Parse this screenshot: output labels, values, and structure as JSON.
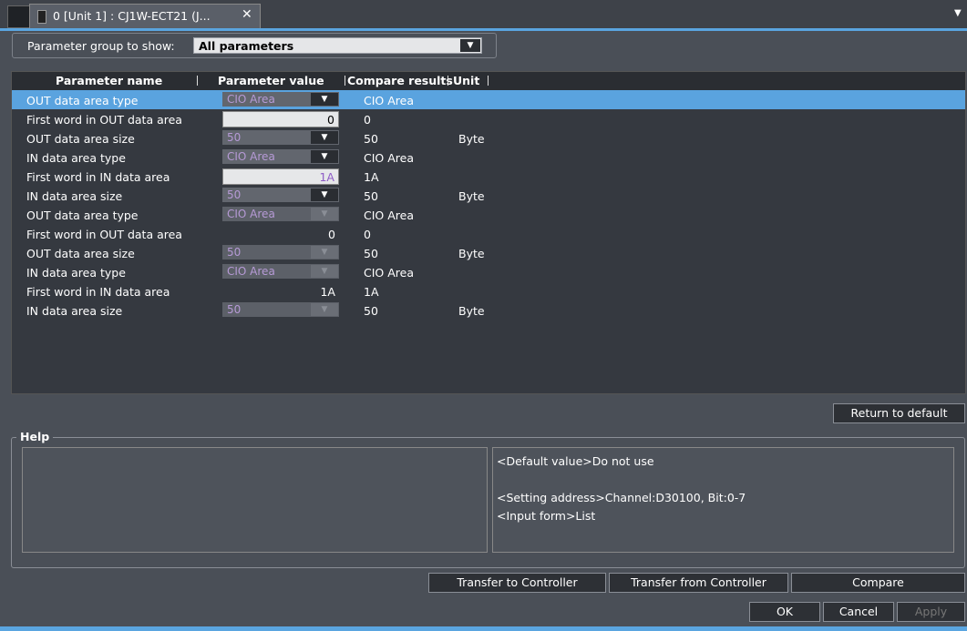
{
  "tab": {
    "title": "0 [Unit 1] : CJ1W-ECT21 (J...",
    "close_glyph": "✕",
    "menu_glyph": "▼"
  },
  "group": {
    "label": "Parameter group to show:",
    "value": "All parameters",
    "arrow": "▼"
  },
  "columns": {
    "name": "Parameter name",
    "value": "Parameter value",
    "compare": "Compare results",
    "unit": "Unit"
  },
  "rows": [
    {
      "name": "OUT data area type",
      "kind": "select",
      "value": "CIO Area",
      "enabled": true,
      "compare": "CIO Area",
      "unit": "",
      "selected": true
    },
    {
      "name": "First word in OUT data area",
      "kind": "input",
      "value": "0",
      "enabled": true,
      "compare": "0",
      "unit": ""
    },
    {
      "name": "OUT data area size",
      "kind": "select",
      "value": "50",
      "enabled": true,
      "compare": "50",
      "unit": "Byte"
    },
    {
      "name": "IN data area type",
      "kind": "select",
      "value": "CIO Area",
      "enabled": true,
      "compare": "CIO Area",
      "unit": ""
    },
    {
      "name": "First word in IN data area",
      "kind": "input",
      "value": "1A",
      "enabled": true,
      "compare": "1A",
      "unit": "",
      "changed": true
    },
    {
      "name": "IN data area size",
      "kind": "select",
      "value": "50",
      "enabled": true,
      "compare": "50",
      "unit": "Byte"
    },
    {
      "name": "OUT data area type",
      "kind": "select",
      "value": "CIO Area",
      "enabled": false,
      "compare": "CIO Area",
      "unit": ""
    },
    {
      "name": "First word in OUT data area",
      "kind": "readonly",
      "value": "0",
      "enabled": false,
      "compare": "0",
      "unit": ""
    },
    {
      "name": "OUT data area size",
      "kind": "select",
      "value": "50",
      "enabled": false,
      "compare": "50",
      "unit": "Byte"
    },
    {
      "name": "IN data area type",
      "kind": "select",
      "value": "CIO Area",
      "enabled": false,
      "compare": "CIO Area",
      "unit": ""
    },
    {
      "name": "First word in IN data area",
      "kind": "readonly",
      "value": "1A",
      "enabled": false,
      "compare": "1A",
      "unit": ""
    },
    {
      "name": "IN data area size",
      "kind": "select",
      "value": "50",
      "enabled": false,
      "compare": "50",
      "unit": "Byte"
    }
  ],
  "dropdown_arrow": "▼",
  "buttons": {
    "return_default": "Return to default",
    "transfer_to": "Transfer to Controller",
    "transfer_from": "Transfer from Controller",
    "compare": "Compare",
    "ok": "OK",
    "cancel": "Cancel",
    "apply": "Apply"
  },
  "help": {
    "title": "Help",
    "lines": [
      "<Default value>Do not use",
      "<Setting address>Channel:D30100, Bit:0-7",
      "<Input form>List"
    ]
  },
  "colors": {
    "accent": "#5aa5e0",
    "selected_row": "#5aa3df",
    "select_text": "#b69ad6",
    "changed_value": "#8e5cc6"
  }
}
